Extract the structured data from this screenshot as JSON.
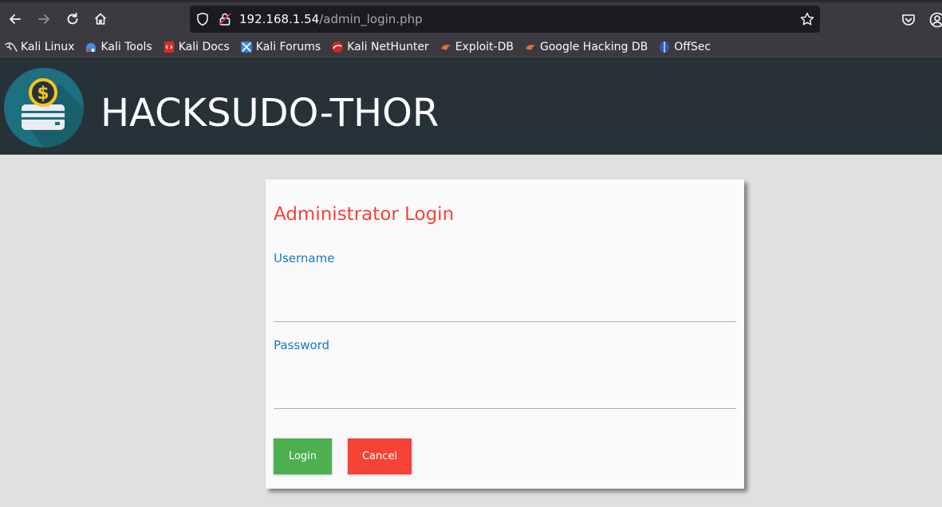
{
  "browser": {
    "url_host": "192.168.1.54",
    "url_path": "/admin_login.php",
    "bookmarks": [
      {
        "label": "Kali Linux",
        "icon": "kali-dragon-icon"
      },
      {
        "label": "Kali Tools",
        "icon": "kali-tools-icon"
      },
      {
        "label": "Kali Docs",
        "icon": "kali-docs-icon"
      },
      {
        "label": "Kali Forums",
        "icon": "kali-forums-icon"
      },
      {
        "label": "Kali NetHunter",
        "icon": "kali-nethunter-icon"
      },
      {
        "label": "Exploit-DB",
        "icon": "exploit-db-icon"
      },
      {
        "label": "Google Hacking DB",
        "icon": "exploit-db-icon"
      },
      {
        "label": "OffSec",
        "icon": "offsec-icon"
      }
    ]
  },
  "header": {
    "title": "HACKSUDO-THOR"
  },
  "login": {
    "title": "Administrator Login",
    "username_label": "Username",
    "username_value": "",
    "password_label": "Password",
    "password_value": "",
    "login_button": "Login",
    "cancel_button": "Cancel"
  },
  "colors": {
    "header_bg": "#263238",
    "title_red": "#f44336",
    "label_blue": "#1976d2",
    "login_green": "#4caf50",
    "cancel_red": "#f44336"
  }
}
